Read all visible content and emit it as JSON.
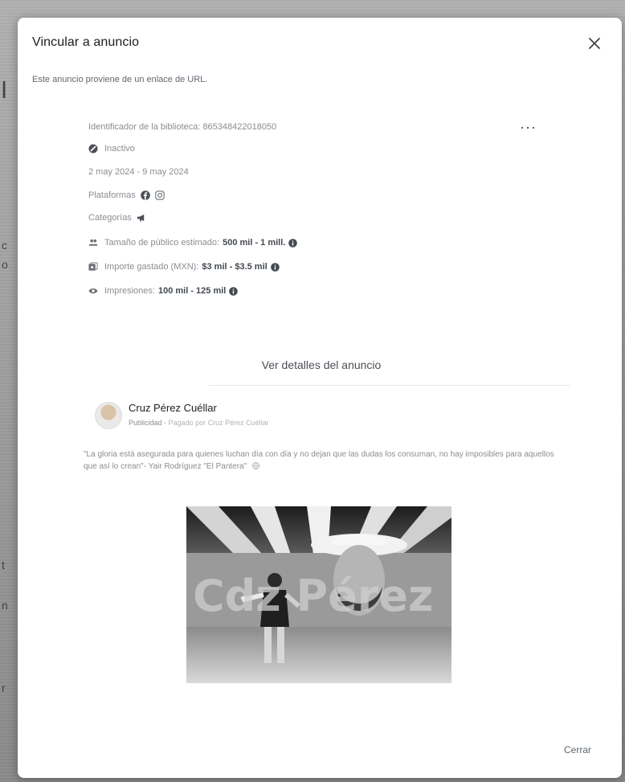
{
  "dialog": {
    "title": "Vincular a anuncio",
    "subtitle": "Este anuncio proviene de un enlace de URL.",
    "close_label": "Cerrar",
    "library_id_label": "Identificador de la biblioteca:",
    "library_id": "865348422018050",
    "status": "Inactivo",
    "date_range": "2 may 2024 - 9 may 2024",
    "platforms_label": "Plataformas",
    "categories_label": "Categorías",
    "audience_label": "Tamaño de público estimado:",
    "audience_value": "500 mil - 1 mill.",
    "spend_label": "Importe gastado (MXN):",
    "spend_value": "$3 mil - $3.5 mil",
    "impressions_label": "Impresiones:",
    "impressions_value": "100 mil - 125 mil",
    "details_link": "Ver detalles del anuncio"
  },
  "ad": {
    "advertiser": "Cruz Pérez Cuéllar",
    "sponsored": "Publicidad",
    "paid_by_label": "Pagado por",
    "paid_by": "Cruz Pérez Cuéllar",
    "text": "\"La gloria está asegurada para quienes luchan día con día y no dejan que las dudas los consuman, no hay imposibles para aquellos que así lo crean\"- Yair Rodríguez \"El Pantera\"",
    "image_banner_text": "Cdz Pérez"
  },
  "icons": {
    "close": "close-icon",
    "more": "more-options-icon",
    "status": "inactive-status-icon",
    "facebook": "facebook-icon",
    "instagram": "instagram-icon",
    "category": "megaphone-icon",
    "audience": "people-icon",
    "spend": "money-icon",
    "impressions": "eye-icon",
    "info": "info-icon",
    "globe": "globe-icon"
  },
  "colors": {
    "background": "#9c9c9c",
    "modal": "#ffffff",
    "text_primary": "#1c1e21",
    "text_secondary": "#8a8d91"
  }
}
